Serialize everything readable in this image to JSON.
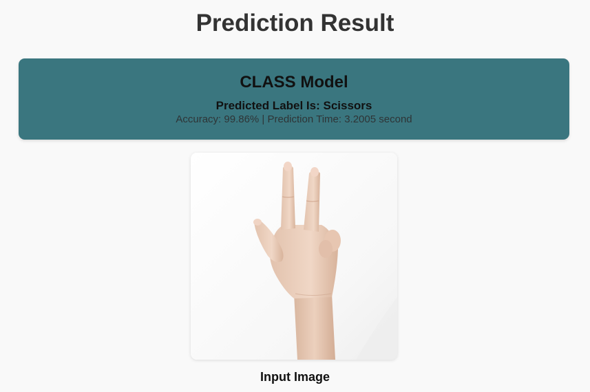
{
  "page": {
    "title": "Prediction Result"
  },
  "result": {
    "model_name": "CLASS Model",
    "predicted_label_text": "Predicted Label Is: Scissors",
    "stats_text": "Accuracy: 99.86% | Prediction Time: 3.2005 second"
  },
  "input_image": {
    "caption": "Input Image",
    "depicts": "hand-scissors-gesture"
  },
  "colors": {
    "card_background": "#3a767f",
    "page_background": "#f9f9f9"
  }
}
